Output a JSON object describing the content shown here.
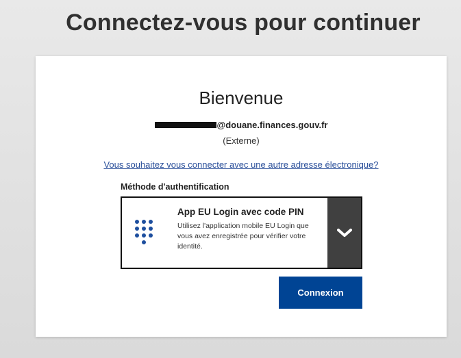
{
  "page": {
    "heading": "Connectez-vous pour continuer"
  },
  "card": {
    "welcome": "Bienvenue",
    "email_visible": "@douane.finances.gouv.fr",
    "account_type": "(Externe)",
    "other_email_link": "Vous souhaitez vous connecter avec une autre adresse électronique?",
    "method_label": "Méthode d'authentification",
    "method": {
      "title": "App EU Login avec code PIN",
      "description": "Utilisez l'application mobile EU Login que vous avez enregistrée pour vérifier votre identité.",
      "icon": "keypad-icon",
      "dropdown_icon": "chevron-down-icon"
    },
    "connect_button": "Connexion"
  },
  "colors": {
    "primary_button": "#004494",
    "link": "#2a4f9a",
    "dropdown_bg": "#404040",
    "keypad": "#1d4e9e"
  }
}
